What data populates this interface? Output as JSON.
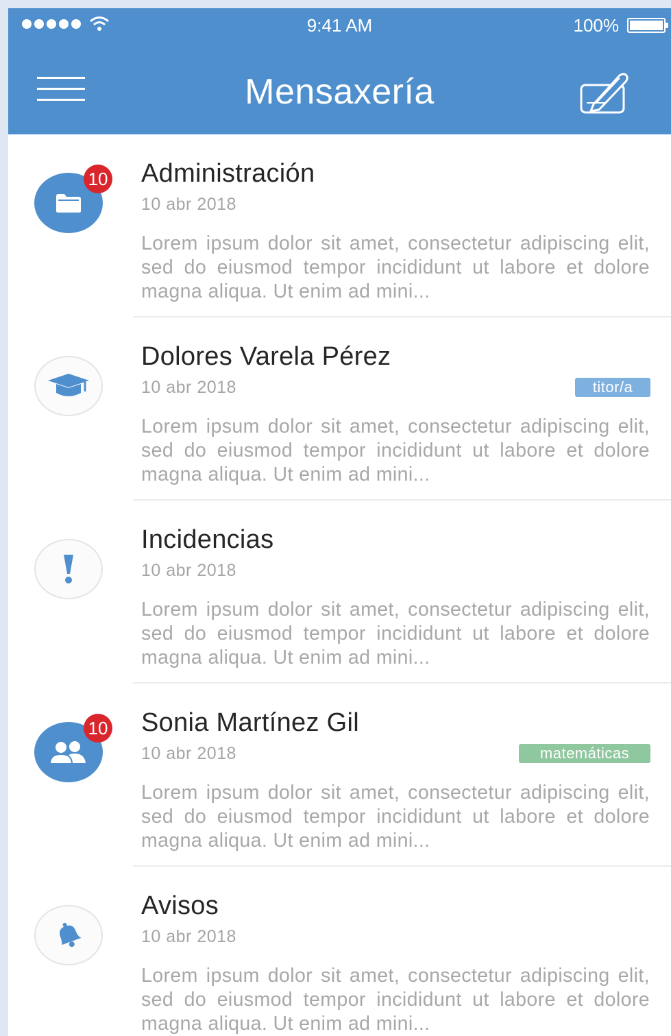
{
  "status_bar": {
    "time": "9:41 AM",
    "battery": "100%",
    "signal_icon": "signal-dots-icon",
    "wifi_icon": "wifi-icon",
    "battery_icon": "battery-full-icon"
  },
  "header": {
    "title": "Mensaxería",
    "menu_icon": "hamburger-menu-icon",
    "compose_icon": "compose-pen-icon",
    "color": "#4f8fcd"
  },
  "messages": [
    {
      "name": "Administración",
      "date": "10 abr 2018",
      "badge": "10",
      "tag": "",
      "icon": "folder-icon",
      "body": "Lorem ipsum dolor sit amet, consectetur adipiscing elit, sed do eiusmod tempor incididunt ut labore et dolore magna aliqua. Ut enim ad mini..."
    },
    {
      "name": "Dolores Varela Pérez",
      "date": "10 abr 2018",
      "badge": "",
      "tag": "titor/a",
      "tag_color": "#7fb1e0",
      "icon": "graduation-cap-icon",
      "body": "Lorem ipsum dolor sit amet, consectetur adipiscing elit, sed do eiusmod tempor incididunt ut labore et dolore magna aliqua. Ut enim ad mini..."
    },
    {
      "name": "Incidencias",
      "date": "10 abr 2018",
      "badge": "",
      "tag": "",
      "icon": "exclamation-icon",
      "body": "Lorem ipsum dolor sit amet, consectetur adipiscing elit, sed do eiusmod tempor incididunt ut labore et dolore magna aliqua. Ut enim ad mini..."
    },
    {
      "name": "Sonia Martínez Gil",
      "date": "10 abr 2018",
      "badge": "10",
      "tag": "matemáticas",
      "tag_color": "#8fc79f",
      "icon": "users-icon",
      "body": "Lorem ipsum dolor sit amet, consectetur adipiscing elit, sed do eiusmod tempor incididunt ut labore et dolore magna aliqua. Ut enim ad mini..."
    },
    {
      "name": "Avisos",
      "date": "10 abr 2018",
      "badge": "",
      "tag": "",
      "icon": "bell-icon",
      "body": "Lorem ipsum dolor sit amet, consectetur adipiscing elit, sed do eiusmod tempor incididunt ut labore et dolore magna aliqua. Ut enim ad mini..."
    }
  ]
}
